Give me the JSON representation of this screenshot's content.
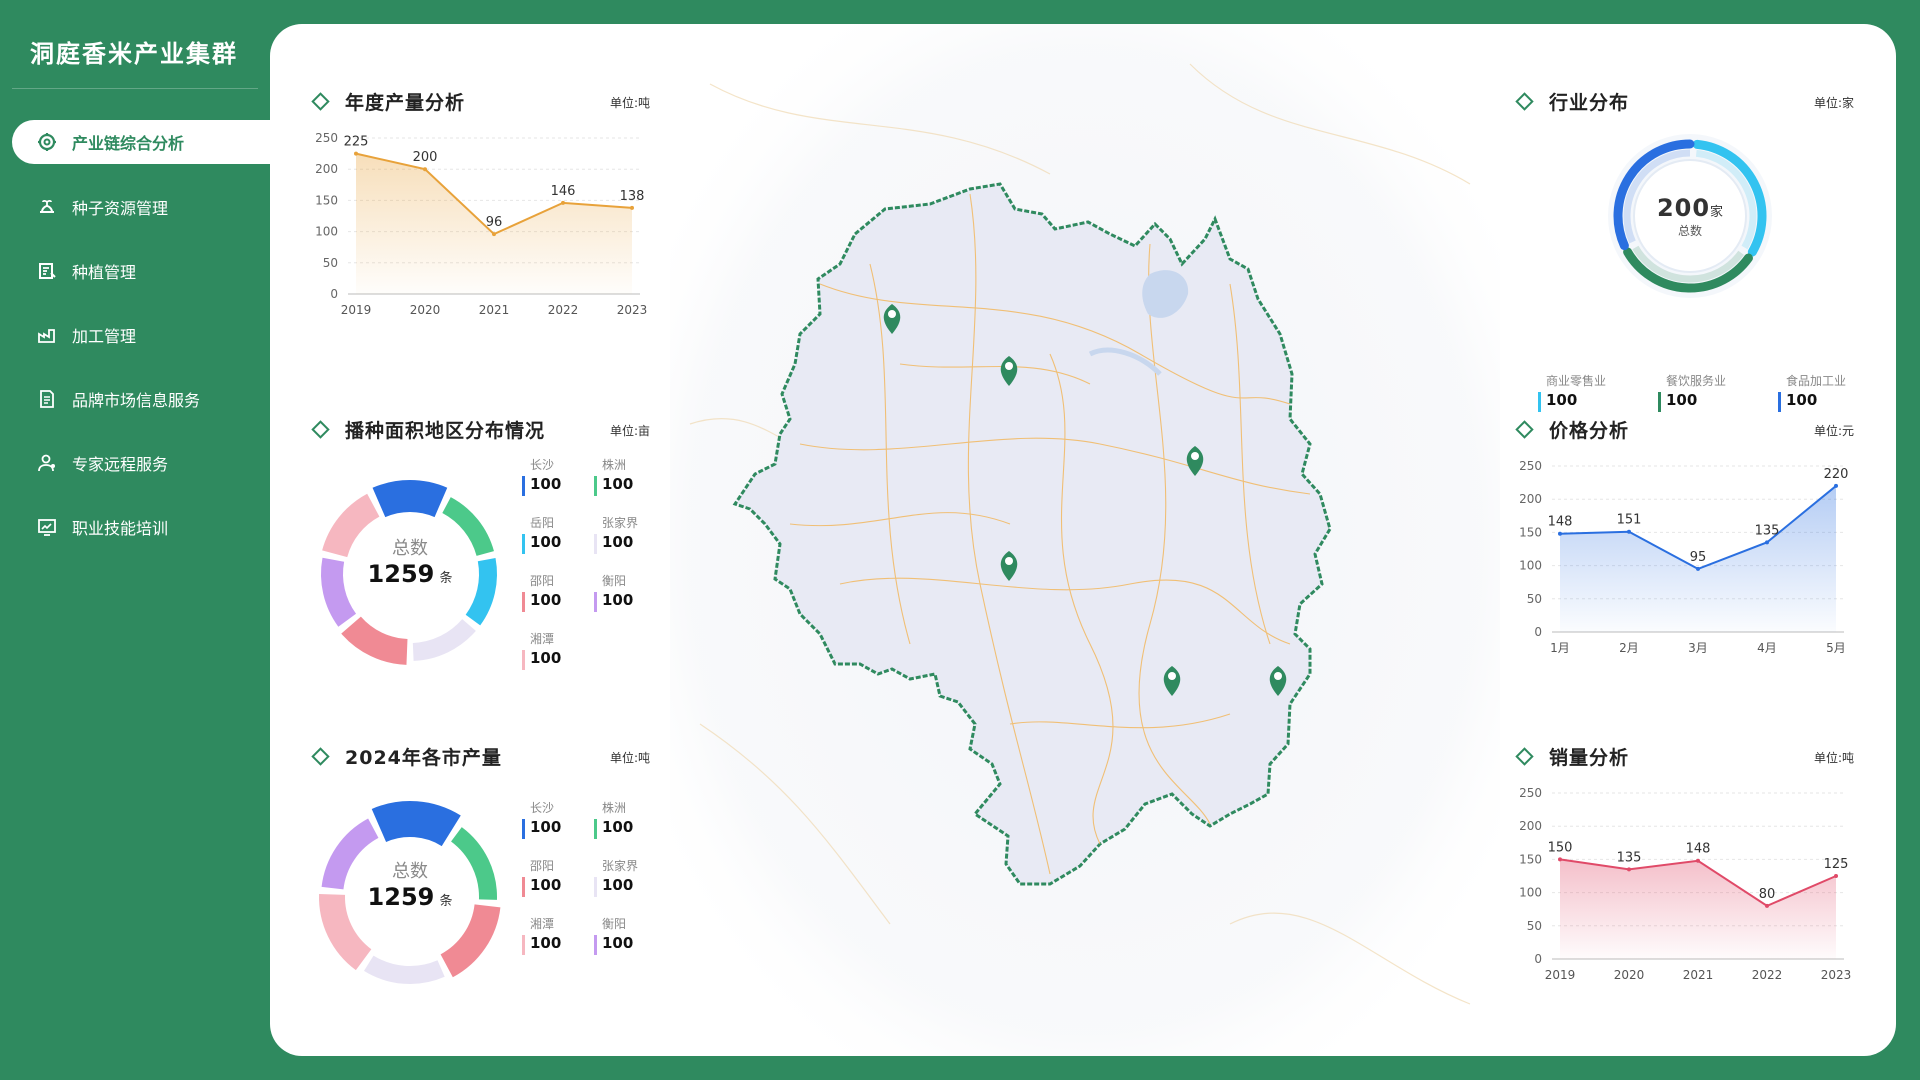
{
  "app_title": "洞庭香米产业集群",
  "nav": [
    {
      "label": "产业链综合分析",
      "icon": "gear-icon",
      "active": true
    },
    {
      "label": "种子资源管理",
      "icon": "seedling-icon",
      "active": false
    },
    {
      "label": "种植管理",
      "icon": "planting-icon",
      "active": false
    },
    {
      "label": "加工管理",
      "icon": "factory-icon",
      "active": false
    },
    {
      "label": "品牌市场信息服务",
      "icon": "document-icon",
      "active": false
    },
    {
      "label": "专家远程服务",
      "icon": "expert-icon",
      "active": false
    },
    {
      "label": "职业技能培训",
      "icon": "training-icon",
      "active": false
    }
  ],
  "colors": {
    "brand": "#2f8a5f",
    "orange": "#e8a23a",
    "blue": "#2a6fe0",
    "red": "#e04a68",
    "cyan": "#33c3f0",
    "green": "#4cc98a",
    "purple": "#c49af0",
    "pink": "#f08a94",
    "lightpink": "#f6b7c0"
  },
  "panels": {
    "annual_output": {
      "title": "年度产量分析",
      "unit": "单位:吨"
    },
    "planting_area": {
      "title": "播种面积地区分布情况",
      "unit": "单位:亩"
    },
    "city_output": {
      "title": "2024年各市产量",
      "unit": "单位:吨"
    },
    "industry": {
      "title": "行业分布",
      "unit": "单位:家"
    },
    "price": {
      "title": "价格分析",
      "unit": "单位:元"
    },
    "sales": {
      "title": "销量分析",
      "unit": "单位:吨"
    }
  },
  "planting_donut": {
    "center_label": "总数",
    "center_value": "1259",
    "center_unit": "条",
    "legend": [
      {
        "name": "长沙",
        "value": "100",
        "color": "#2a6fe0"
      },
      {
        "name": "株洲",
        "value": "100",
        "color": "#4cc98a"
      },
      {
        "name": "岳阳",
        "value": "100",
        "color": "#33c3f0"
      },
      {
        "name": "张家界",
        "value": "100",
        "color": "#e8e4f4"
      },
      {
        "name": "邵阳",
        "value": "100",
        "color": "#f08a94"
      },
      {
        "name": "衡阳",
        "value": "100",
        "color": "#c49af0"
      },
      {
        "name": "湘潭",
        "value": "100",
        "color": "#f6b7c0"
      }
    ]
  },
  "city_donut": {
    "center_label": "总数",
    "center_value": "1259",
    "center_unit": "条",
    "legend": [
      {
        "name": "长沙",
        "value": "100",
        "color": "#2a6fe0"
      },
      {
        "name": "株洲",
        "value": "100",
        "color": "#4cc98a"
      },
      {
        "name": "邵阳",
        "value": "100",
        "color": "#f08a94"
      },
      {
        "name": "张家界",
        "value": "100",
        "color": "#e8e4f4"
      },
      {
        "name": "湘潭",
        "value": "100",
        "color": "#f6b7c0"
      },
      {
        "name": "衡阳",
        "value": "100",
        "color": "#c49af0"
      }
    ]
  },
  "industry_gauge": {
    "value": "200",
    "unit": "家",
    "label": "总数",
    "legend": [
      {
        "name": "商业零售业",
        "value": "100",
        "color": "#33c3f0"
      },
      {
        "name": "餐饮服务业",
        "value": "100",
        "color": "#2f8a5f"
      },
      {
        "name": "食品加工业",
        "value": "100",
        "color": "#2a6fe0"
      }
    ]
  },
  "chart_data": [
    {
      "type": "area",
      "title": "年度产量分析",
      "categories": [
        "2019",
        "2020",
        "2021",
        "2022",
        "2023"
      ],
      "values": [
        225,
        200,
        96,
        146,
        138
      ],
      "ylim": [
        0,
        250
      ],
      "yticks": [
        0,
        50,
        100,
        150,
        200,
        250
      ],
      "color": "#e8a23a"
    },
    {
      "type": "pie",
      "title": "播种面积地区分布情况",
      "categories": [
        "长沙",
        "株洲",
        "岳阳",
        "张家界",
        "邵阳",
        "衡阳",
        "湘潭"
      ],
      "values": [
        100,
        100,
        100,
        100,
        100,
        100,
        100
      ]
    },
    {
      "type": "pie",
      "title": "2024年各市产量",
      "categories": [
        "长沙",
        "株洲",
        "邵阳",
        "张家界",
        "湘潭",
        "衡阳"
      ],
      "values": [
        100,
        100,
        100,
        100,
        100,
        100
      ]
    },
    {
      "type": "pie",
      "title": "行业分布",
      "categories": [
        "商业零售业",
        "餐饮服务业",
        "食品加工业"
      ],
      "values": [
        100,
        100,
        100
      ]
    },
    {
      "type": "area",
      "title": "价格分析",
      "categories": [
        "1月",
        "2月",
        "3月",
        "4月",
        "5月"
      ],
      "values": [
        148,
        151,
        95,
        135,
        220
      ],
      "ylim": [
        0,
        250
      ],
      "yticks": [
        0,
        50,
        100,
        150,
        200,
        250
      ],
      "color": "#2a6fe0"
    },
    {
      "type": "area",
      "title": "销量分析",
      "categories": [
        "2019",
        "2020",
        "2021",
        "2022",
        "2023"
      ],
      "values": [
        150,
        135,
        148,
        80,
        125
      ],
      "ylim": [
        0,
        250
      ],
      "yticks": [
        0,
        50,
        100,
        150,
        200,
        250
      ],
      "color": "#e04a68"
    }
  ]
}
